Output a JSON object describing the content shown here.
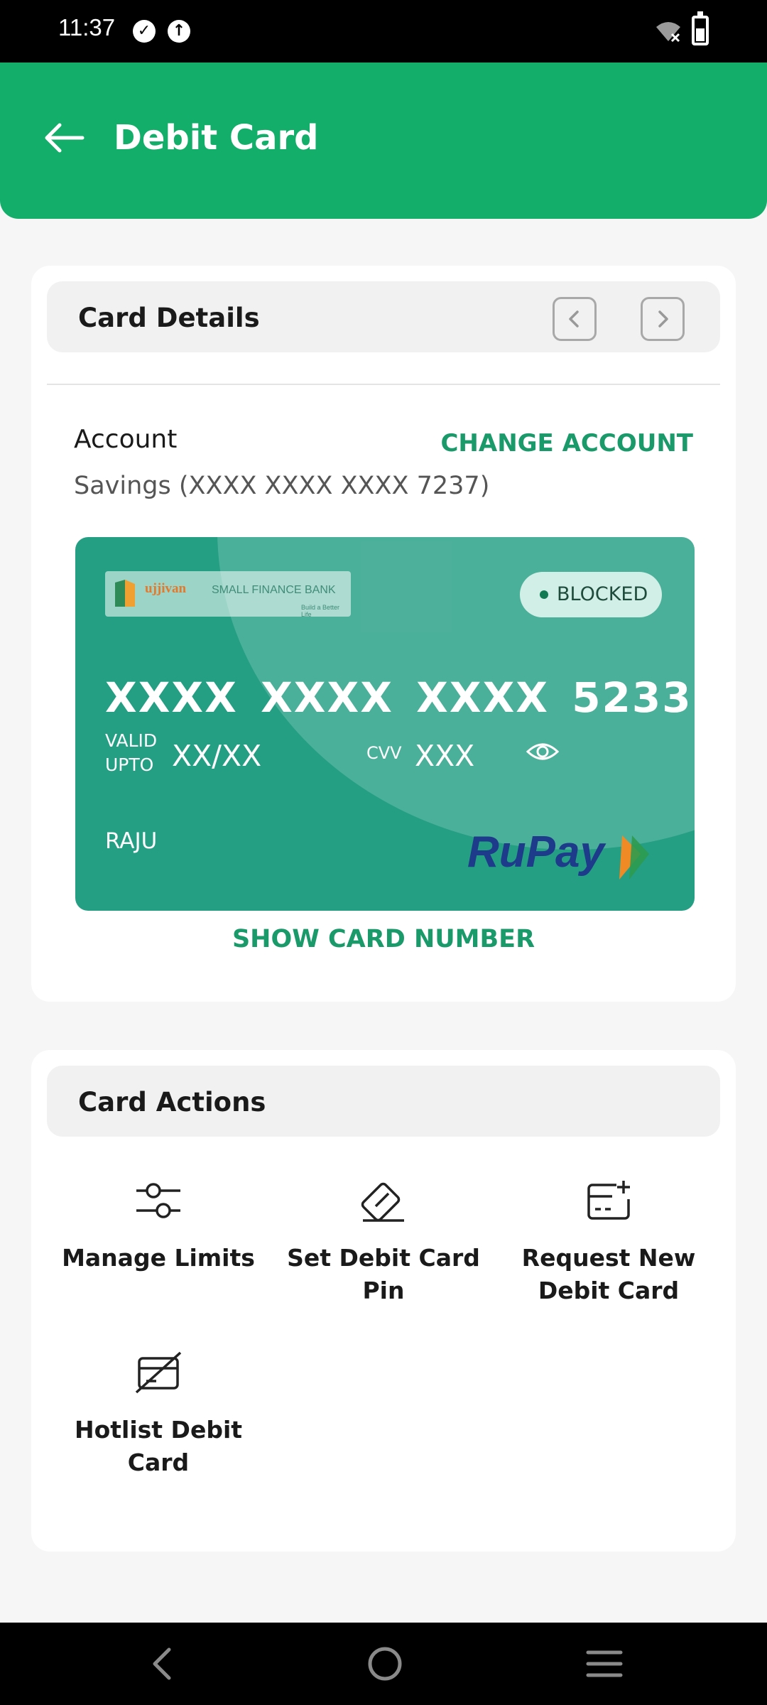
{
  "status_bar": {
    "time": "11:37",
    "icons": [
      "check-circle-icon",
      "upload-circle-icon",
      "wifi-off-icon",
      "battery-icon"
    ]
  },
  "app_bar": {
    "title": "Debit Card",
    "back_icon": "arrow-left-icon"
  },
  "card_details": {
    "header": "Card Details",
    "prev_icon": "chevron-left-icon",
    "next_icon": "chevron-right-icon",
    "account_label": "Account",
    "change_account": "CHANGE ACCOUNT",
    "account_value": "Savings (XXXX XXXX XXXX 7237)",
    "card": {
      "bank_name": "ujjivan",
      "bank_name_suffix": "SMALL FINANCE BANK",
      "bank_tagline": "Build a Better Life",
      "status": "BLOCKED",
      "number": "XXXX XXXX XXXX 5233",
      "valid_label": "VALID UPTO",
      "valid_value": "XX/XX",
      "cvv_label": "CVV",
      "cvv_value": "XXX",
      "holder": "RAJU",
      "network": "RuPay",
      "colors": {
        "card": "#249f84",
        "badge": "#d2efe7"
      }
    },
    "show_number": "SHOW CARD NUMBER"
  },
  "card_actions": {
    "header": "Card Actions",
    "items": [
      {
        "label": "Manage Limits",
        "icon": "sliders-icon"
      },
      {
        "label": "Set Debit Card Pin",
        "icon": "card-pin-icon"
      },
      {
        "label": "Request New Debit Card",
        "icon": "card-add-icon"
      },
      {
        "label": "Hotlist Debit Card",
        "icon": "card-block-icon"
      }
    ]
  },
  "nav_bar": {
    "icons": [
      "nav-back-icon",
      "nav-home-icon",
      "nav-menu-icon"
    ]
  },
  "colors": {
    "brand_green": "#14ae6b",
    "accent_text": "#1a9a6b",
    "background": "#f6f6f6"
  }
}
